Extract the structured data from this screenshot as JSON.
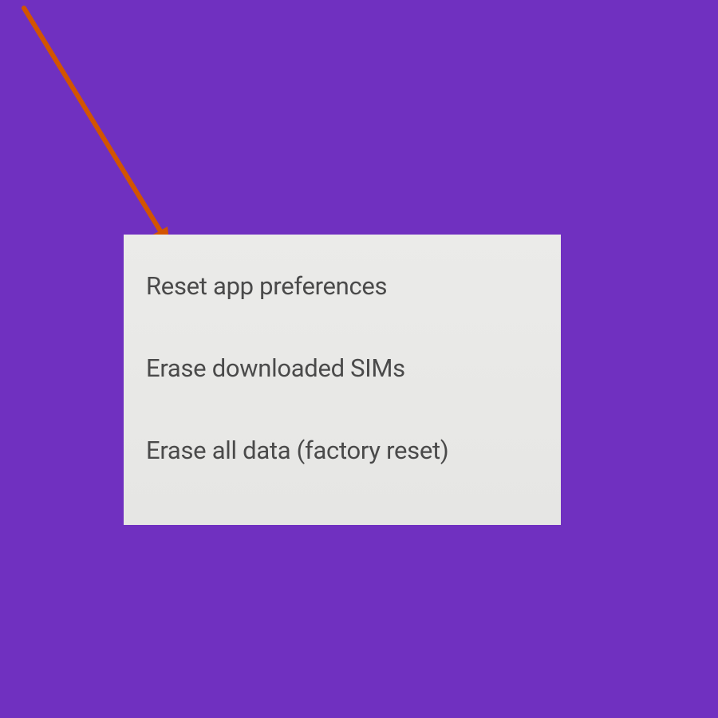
{
  "colors": {
    "background": "#7030c0",
    "panel": "#ebebe9",
    "text": "#4a4a4a",
    "arrow": "#d35400"
  },
  "settings": {
    "items": [
      {
        "label": "Reset app preferences"
      },
      {
        "label": "Erase downloaded SIMs"
      },
      {
        "label": "Erase all data (factory reset)"
      }
    ]
  }
}
